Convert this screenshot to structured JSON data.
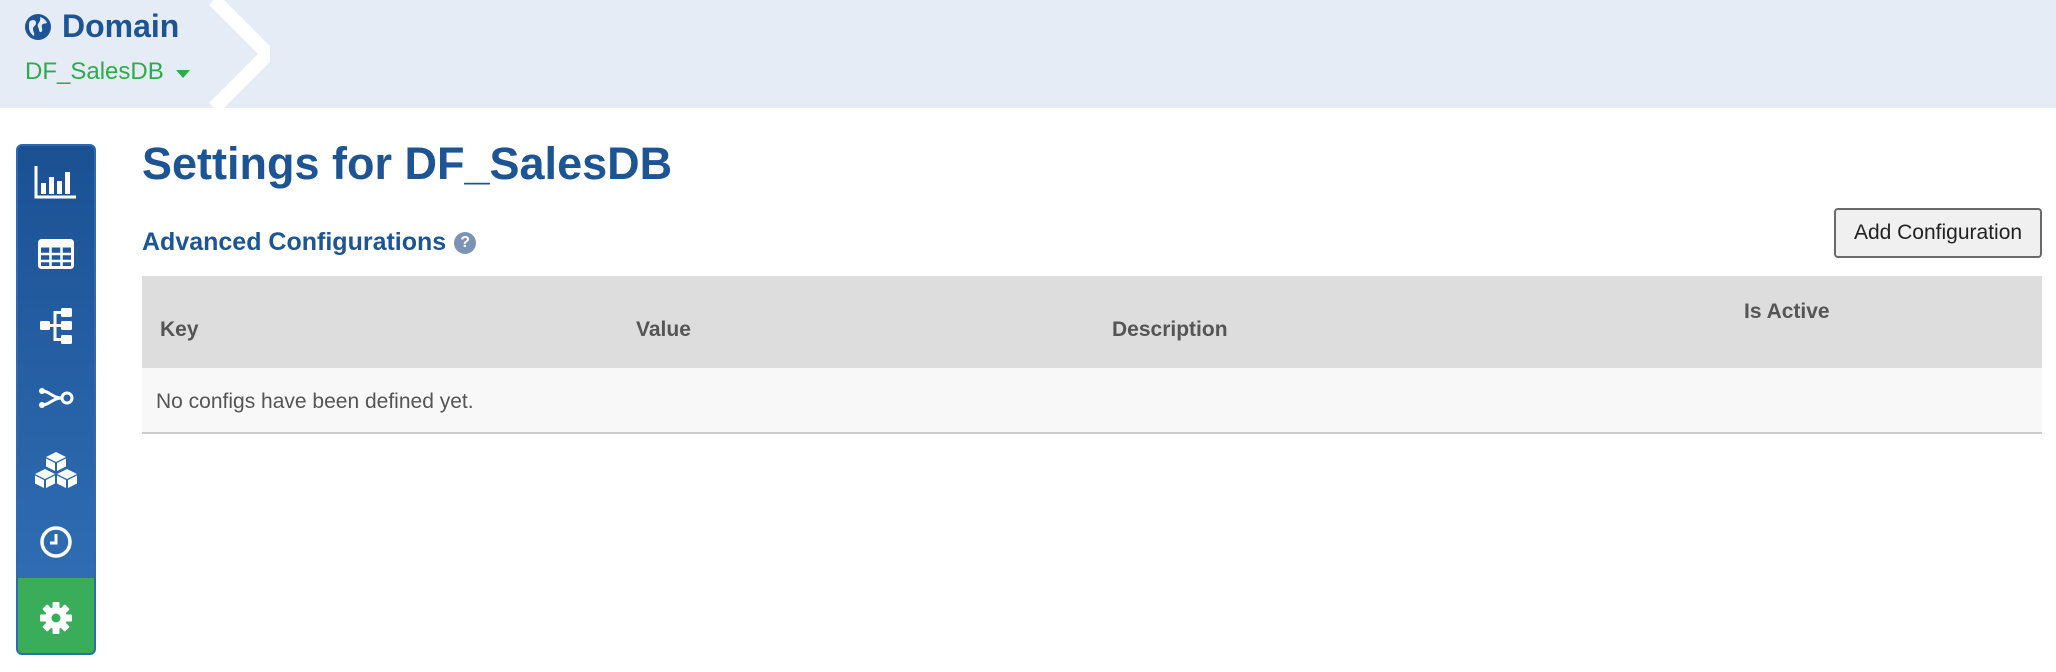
{
  "breadcrumb": {
    "title": "Domain",
    "selected_domain": "DF_SalesDB"
  },
  "sidebar": {
    "items": [
      {
        "name": "statistics",
        "icon": "bar-chart-icon",
        "active": false
      },
      {
        "name": "tables",
        "icon": "table-icon",
        "active": false
      },
      {
        "name": "hierarchy",
        "icon": "sitemap-icon",
        "active": false
      },
      {
        "name": "relationships",
        "icon": "share-nodes-icon",
        "active": false
      },
      {
        "name": "entities",
        "icon": "cubes-icon",
        "active": false
      },
      {
        "name": "history",
        "icon": "clock-icon",
        "active": false
      },
      {
        "name": "settings",
        "icon": "gear-icon",
        "active": true
      }
    ]
  },
  "main": {
    "title": "Settings for DF_SalesDB",
    "section_title": "Advanced Configurations",
    "help_glyph": "?",
    "add_button_label": "Add Configuration",
    "table": {
      "columns": [
        "Key",
        "Value",
        "Description",
        "Is Active"
      ],
      "empty_message": "No configs have been defined yet."
    }
  },
  "colors": {
    "header_bg": "#e6ecf5",
    "brand_blue": "#1d5494",
    "accent_green": "#39ad5a",
    "domain_green": "#2eaa50"
  }
}
